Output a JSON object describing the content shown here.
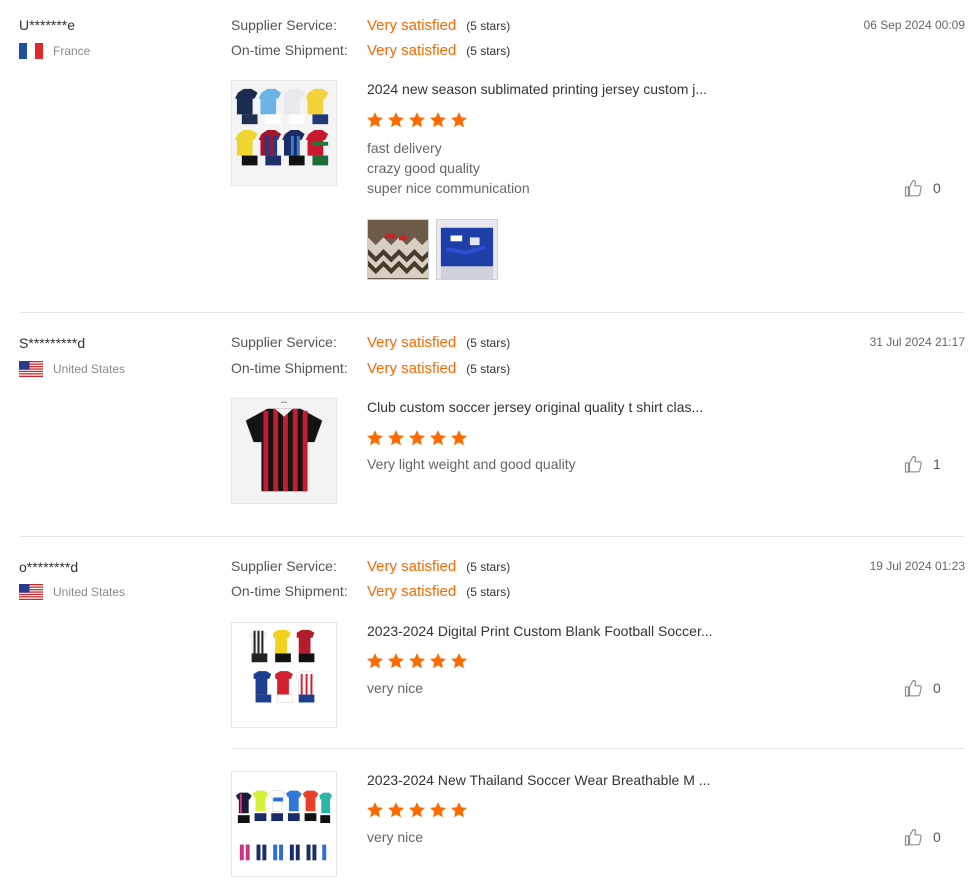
{
  "reviews": [
    {
      "user": "U*******e",
      "country": "France",
      "date": "06 Sep 2024 00:09",
      "supplier_label": "Supplier Service:",
      "supplier_value": "Very satisfied",
      "supplier_stars": "(5 stars)",
      "shipment_label": "On-time Shipment:",
      "shipment_value": "Very satisfied",
      "shipment_stars": "(5 stars)",
      "products": [
        {
          "title": "2024 new season sublimated printing jersey custom j...",
          "rating": 5,
          "comments": [
            "fast delivery",
            "crazy good quality",
            "super nice communication"
          ],
          "likes": "0"
        }
      ]
    },
    {
      "user": "S*********d",
      "country": "United States",
      "date": "31 Jul 2024 21:17",
      "supplier_label": "Supplier Service:",
      "supplier_value": "Very satisfied",
      "supplier_stars": "(5 stars)",
      "shipment_label": "On-time Shipment:",
      "shipment_value": "Very satisfied",
      "shipment_stars": "(5 stars)",
      "products": [
        {
          "title": "Club custom soccer jersey original quality t shirt clas...",
          "rating": 5,
          "comments": [
            "Very light weight and good quality"
          ],
          "likes": "1"
        }
      ]
    },
    {
      "user": "o********d",
      "country": "United States",
      "date": "19 Jul 2024 01:23",
      "supplier_label": "Supplier Service:",
      "supplier_value": "Very satisfied",
      "supplier_stars": "(5 stars)",
      "shipment_label": "On-time Shipment:",
      "shipment_value": "Very satisfied",
      "shipment_stars": "(5 stars)",
      "products": [
        {
          "title": "2023-2024 Digital Print Custom Blank Football Soccer...",
          "rating": 5,
          "comments": [
            "very nice"
          ],
          "likes": "0"
        },
        {
          "title": "2023-2024 New Thailand Soccer Wear Breathable M ...",
          "rating": 5,
          "comments": [
            "very nice"
          ],
          "likes": "0"
        }
      ]
    }
  ],
  "colors": {
    "accent": "#ff6600",
    "star": "#ff6a00",
    "divider": "#e3e3e3"
  },
  "icons": {
    "like": "thumbs-up-icon",
    "rating": "star-icon",
    "flag_fr": "france-flag-icon",
    "flag_us": "us-flag-icon"
  }
}
